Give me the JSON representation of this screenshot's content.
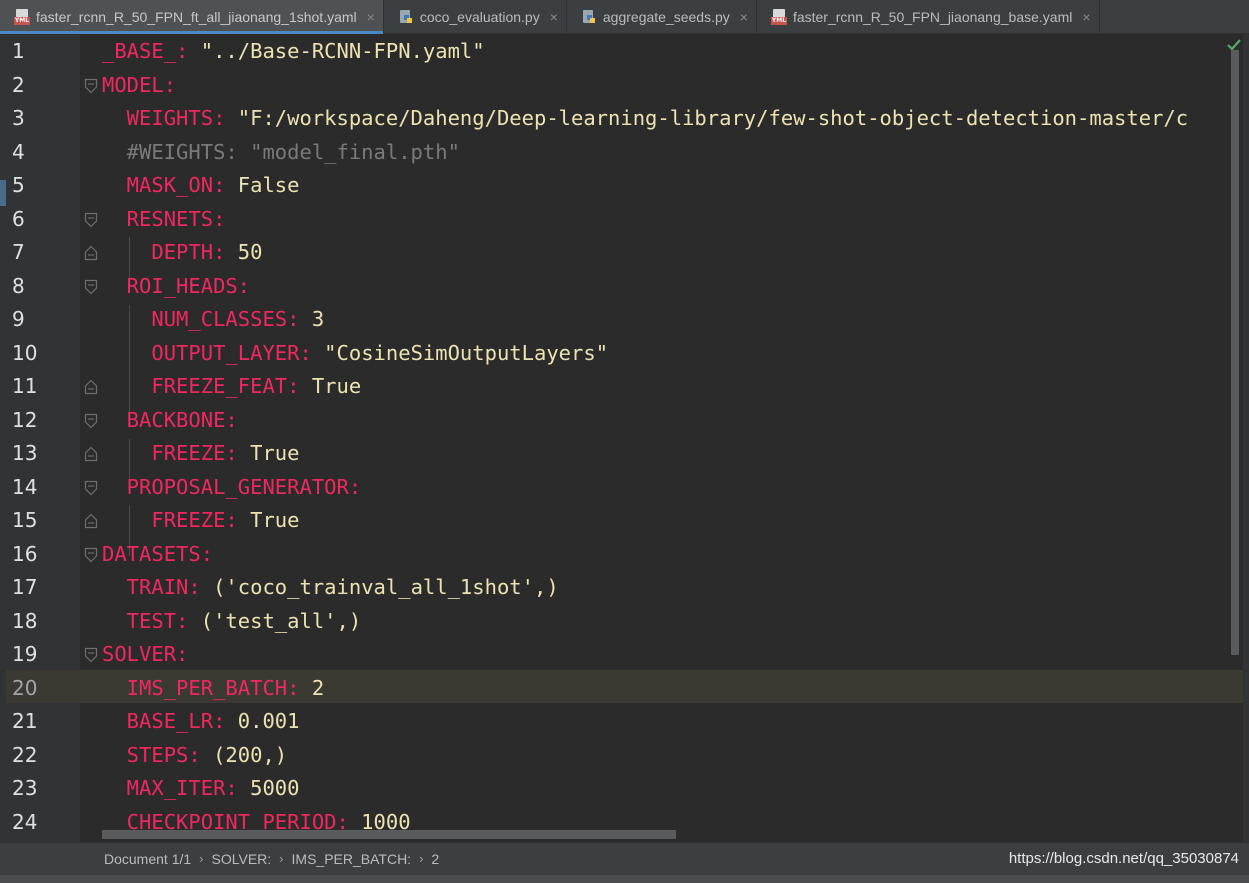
{
  "tabs": [
    {
      "label": "faster_rcnn_R_50_FPN_ft_all_jiaonang_1shot.yaml",
      "icon": "yaml-file-icon",
      "active": true
    },
    {
      "label": "coco_evaluation.py",
      "icon": "python-file-icon",
      "active": false
    },
    {
      "label": "aggregate_seeds.py",
      "icon": "python-file-icon",
      "active": false
    },
    {
      "label": "faster_rcnn_R_50_FPN_jiaonang_base.yaml",
      "icon": "yaml-file-icon",
      "active": false
    }
  ],
  "tab_close_glyph": "×",
  "yaml_icon_text": "YML",
  "lines": [
    {
      "n": "1",
      "key": "_BASE_:",
      "val": " \"../Base-RCNN-FPN.yaml\""
    },
    {
      "n": "2",
      "key": "MODEL:",
      "val": ""
    },
    {
      "n": "3",
      "key": "  WEIGHTS:",
      "val": " \"F:/workspace/Daheng/Deep-learning-library/few-shot-object-detection-master/c"
    },
    {
      "n": "4",
      "key": "",
      "val": "",
      "comment": "  #WEIGHTS: \"model_final.pth\""
    },
    {
      "n": "5",
      "key": "  MASK_ON:",
      "val": " False"
    },
    {
      "n": "6",
      "key": "  RESNETS:",
      "val": ""
    },
    {
      "n": "7",
      "key": "    DEPTH:",
      "val": " 50"
    },
    {
      "n": "8",
      "key": "  ROI_HEADS:",
      "val": ""
    },
    {
      "n": "9",
      "key": "    NUM_CLASSES:",
      "val": " 3"
    },
    {
      "n": "10",
      "key": "    OUTPUT_LAYER:",
      "val": " \"CosineSimOutputLayers\""
    },
    {
      "n": "11",
      "key": "    FREEZE_FEAT:",
      "val": " True"
    },
    {
      "n": "12",
      "key": "  BACKBONE:",
      "val": ""
    },
    {
      "n": "13",
      "key": "    FREEZE:",
      "val": " True"
    },
    {
      "n": "14",
      "key": "  PROPOSAL_GENERATOR:",
      "val": ""
    },
    {
      "n": "15",
      "key": "    FREEZE:",
      "val": " True"
    },
    {
      "n": "16",
      "key": "DATASETS:",
      "val": ""
    },
    {
      "n": "17",
      "key": "  TRAIN:",
      "val": " ('coco_trainval_all_1shot',)"
    },
    {
      "n": "18",
      "key": "  TEST:",
      "val": " ('test_all',)"
    },
    {
      "n": "19",
      "key": "SOLVER:",
      "val": ""
    },
    {
      "n": "20",
      "key": "  IMS_PER_BATCH:",
      "val": " 2"
    },
    {
      "n": "21",
      "key": "  BASE_LR:",
      "val": " 0.001"
    },
    {
      "n": "22",
      "key": "  STEPS:",
      "val": " (200,)"
    },
    {
      "n": "23",
      "key": "  MAX_ITER:",
      "val": " 5000"
    },
    {
      "n": "24",
      "key": "  CHECKPOINT_PERIOD:",
      "val": " 1000"
    }
  ],
  "current_line": "20",
  "breadcrumb": {
    "document": "Document 1/1",
    "sep": "›",
    "items": [
      "SOLVER:",
      "IMS_PER_BATCH:",
      "2"
    ]
  },
  "watermark": "https://blog.csdn.net/qq_35030874",
  "colors": {
    "key": "#f0285f",
    "value": "#ece3b1",
    "comment": "#7a7a7a",
    "background": "#2b2b2b",
    "tab_accent": "#4a88c7"
  }
}
